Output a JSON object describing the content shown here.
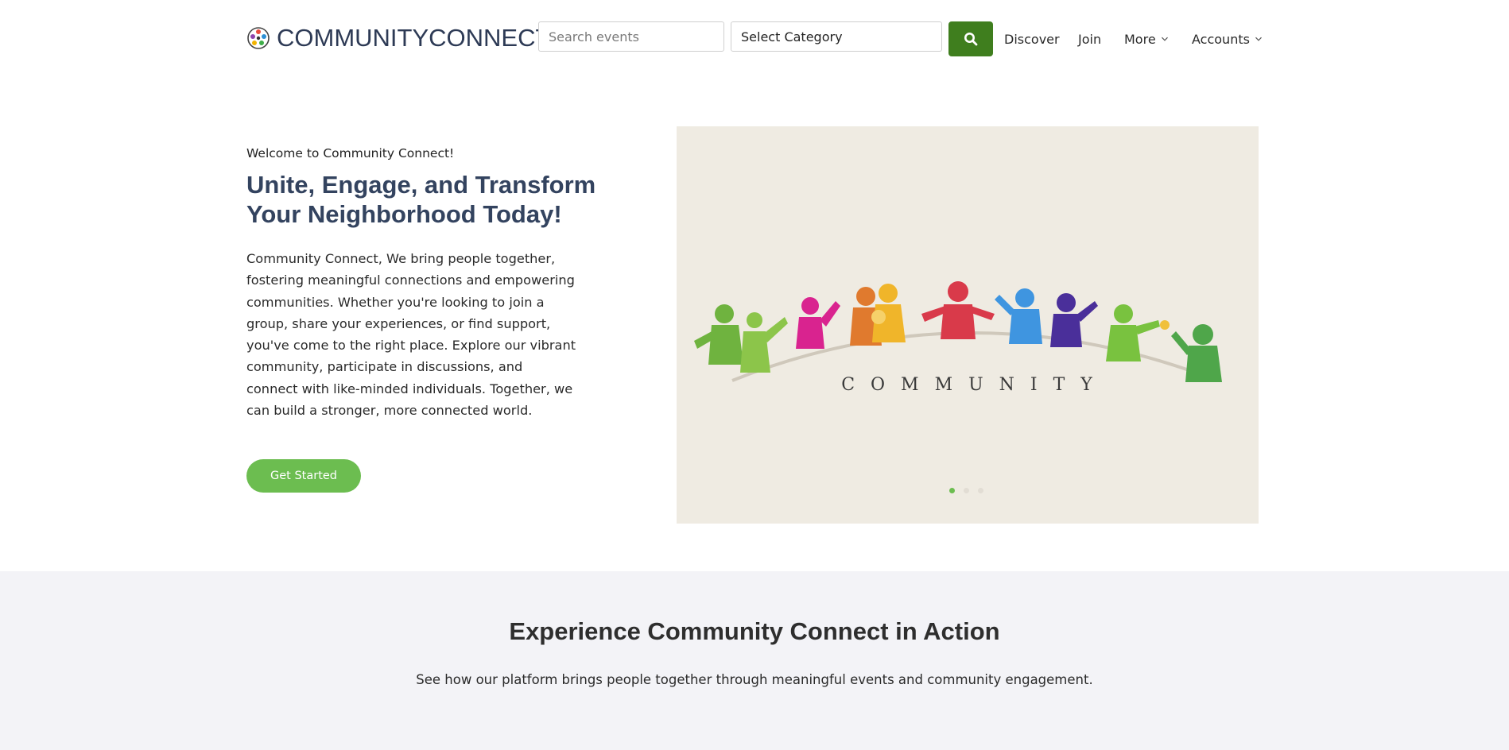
{
  "header": {
    "logo_text": "COMMUNITYCONNECT",
    "search_placeholder": "Search events",
    "category_selected": "Select Category",
    "nav": {
      "discover": "Discover",
      "join": "Join",
      "more": "More",
      "accounts": "Accounts"
    }
  },
  "hero": {
    "eyebrow": "Welcome to Community Connect!",
    "title": "Unite, Engage, and Transform Your Neighborhood Today!",
    "description": "Community Connect, We bring people together, fostering meaningful connections and empowering communities. Whether you're looking to join a group, share your experiences, or find support, you've come to the right place. Explore our vibrant community, participate in discussions, and connect with like-minded individuals. Together, we can build a stronger, more connected world.",
    "cta_label": "Get Started",
    "slider_image_text": "COMMUNITY",
    "slider_dots": [
      {
        "active": true
      },
      {
        "active": false
      },
      {
        "active": false
      }
    ]
  },
  "section2": {
    "title": "Experience Community Connect in Action",
    "subtitle": "See how our platform brings people together through meaningful events and community engagement."
  },
  "colors": {
    "brand_green": "#6cbd50",
    "search_button": "#3f7e1e",
    "heading_navy": "#33435f",
    "section_bg": "#f3f3f7",
    "slide_bg": "#efebe2"
  },
  "icons": {
    "search": "search-icon",
    "chevron": "chevron-down-icon",
    "logo": "community-logo-icon"
  }
}
